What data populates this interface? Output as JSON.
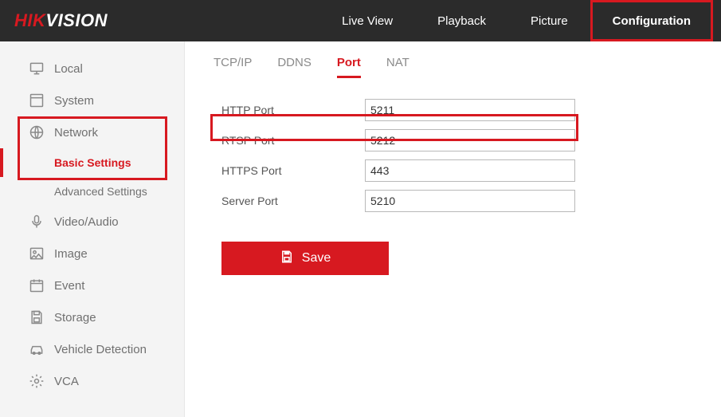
{
  "logo": {
    "hik": "HIK",
    "vision": "VISION"
  },
  "topnav": {
    "items": [
      {
        "label": "Live View"
      },
      {
        "label": "Playback"
      },
      {
        "label": "Picture"
      },
      {
        "label": "Configuration"
      }
    ]
  },
  "sidebar": {
    "items": [
      {
        "label": "Local"
      },
      {
        "label": "System"
      },
      {
        "label": "Network"
      },
      {
        "label": "Video/Audio"
      },
      {
        "label": "Image"
      },
      {
        "label": "Event"
      },
      {
        "label": "Storage"
      },
      {
        "label": "Vehicle Detection"
      },
      {
        "label": "VCA"
      }
    ],
    "network_sub": [
      {
        "label": "Basic Settings"
      },
      {
        "label": "Advanced Settings"
      }
    ]
  },
  "tabs": [
    {
      "label": "TCP/IP"
    },
    {
      "label": "DDNS"
    },
    {
      "label": "Port"
    },
    {
      "label": "NAT"
    }
  ],
  "form": {
    "rows": [
      {
        "label": "HTTP Port",
        "value": "5211"
      },
      {
        "label": "RTSP Port",
        "value": "5212"
      },
      {
        "label": "HTTPS Port",
        "value": "443"
      },
      {
        "label": "Server Port",
        "value": "5210"
      }
    ]
  },
  "buttons": {
    "save": "Save"
  },
  "colors": {
    "accent": "#d71920",
    "topbar": "#2b2b2b",
    "sidebar": "#f4f4f4"
  }
}
